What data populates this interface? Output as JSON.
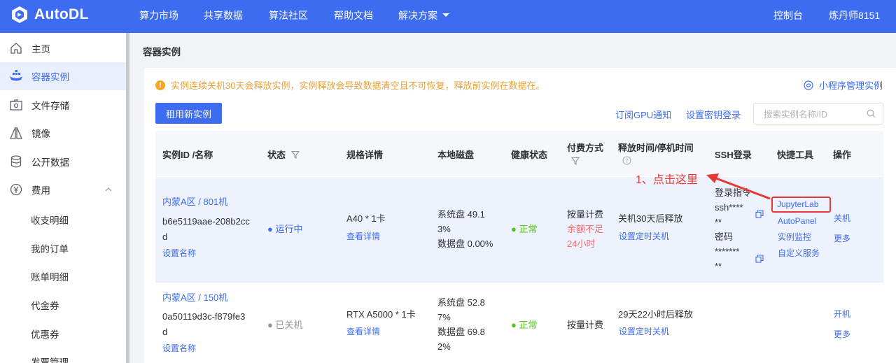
{
  "topnav": {
    "logo": "AutoDL",
    "items": [
      "算力市场",
      "共享数据",
      "算法社区",
      "帮助文档",
      "解决方案"
    ],
    "console": "控制台",
    "user": "炼丹师8151"
  },
  "sidebar": {
    "items": [
      {
        "label": "主页",
        "icon": "home-icon"
      },
      {
        "label": "容器实例",
        "icon": "container-icon"
      },
      {
        "label": "文件存储",
        "icon": "storage-icon"
      },
      {
        "label": "镜像",
        "icon": "image-icon"
      },
      {
        "label": "公开数据",
        "icon": "database-icon"
      },
      {
        "label": "费用",
        "icon": "yen-icon"
      }
    ],
    "sub_items": [
      "收支明细",
      "我的订单",
      "账单明细",
      "代金券",
      "优惠券",
      "发票管理"
    ]
  },
  "page": {
    "title": "容器实例",
    "warning": "实例连续关机30天会释放实例，实例释放会导致数据清空且不可恢复，释放前实例在数据在。",
    "mini_manage": "小程序管理实例",
    "new_button": "租用新实例",
    "subscribe_gpu": "订阅GPU通知",
    "set_key": "设置密钥登录",
    "search_placeholder": "搜索实例名称/ID"
  },
  "table": {
    "headers": {
      "id": "实例ID /名称",
      "status": "状态",
      "spec": "规格详情",
      "disk": "本地磁盘",
      "health": "健康状态",
      "pay": "付费方式",
      "release": "释放时间/停机时间",
      "ssh": "SSH登录",
      "tools": "快捷工具",
      "ops": "操作"
    },
    "rows": [
      {
        "region": "内蒙A区 / 801机",
        "id_line1": "b6e5119aae-208b2cc",
        "id_line2": "d",
        "set_name": "设置名称",
        "status": "运行中",
        "spec": "A40 * 1卡",
        "spec_link": "查看详情",
        "disk_l1": "系统盘 49.1",
        "disk_l2": "3%",
        "disk_l3": "数据盘 0.00%",
        "health": "正常",
        "pay": "按量计费",
        "pay_warn_l1": "余额不足",
        "pay_warn_l2": "24小时",
        "release": "关机30天后释放",
        "release_link": "设置定时关机",
        "ssh_l1": "登录指令",
        "ssh_l2": "ssh****",
        "ssh_l3": "**",
        "ssh_l4": "密码",
        "ssh_l5": "*******",
        "ssh_l6": "**",
        "tool_1": "JupyterLab",
        "tool_2": "AutoPanel",
        "tool_3": "实例监控",
        "tool_4": "自定义服务",
        "op_1": "关机",
        "op_2": "更多"
      },
      {
        "region": "内蒙A区 / 150机",
        "id_line1": "0a50119d3c-f879fe3",
        "id_line2": "d",
        "set_name": "设置名称",
        "status": "已关机",
        "spec": "RTX A5000 * 1卡",
        "spec_link": "查看详情",
        "disk_l1": "系统盘 52.8",
        "disk_l2": "7%",
        "disk_l3": "数据盘 69.8",
        "disk_l4": "2%",
        "health": "正常",
        "pay": "按量计费",
        "release": "29天22小时后释放",
        "release_link": "设置定时关机",
        "op_1": "开机",
        "op_2": "更多"
      }
    ]
  },
  "annotation": "1、点击这里",
  "colors": {
    "brand": "#3d6cf0",
    "annotation": "#e53935",
    "warning": "#e6a23c"
  }
}
